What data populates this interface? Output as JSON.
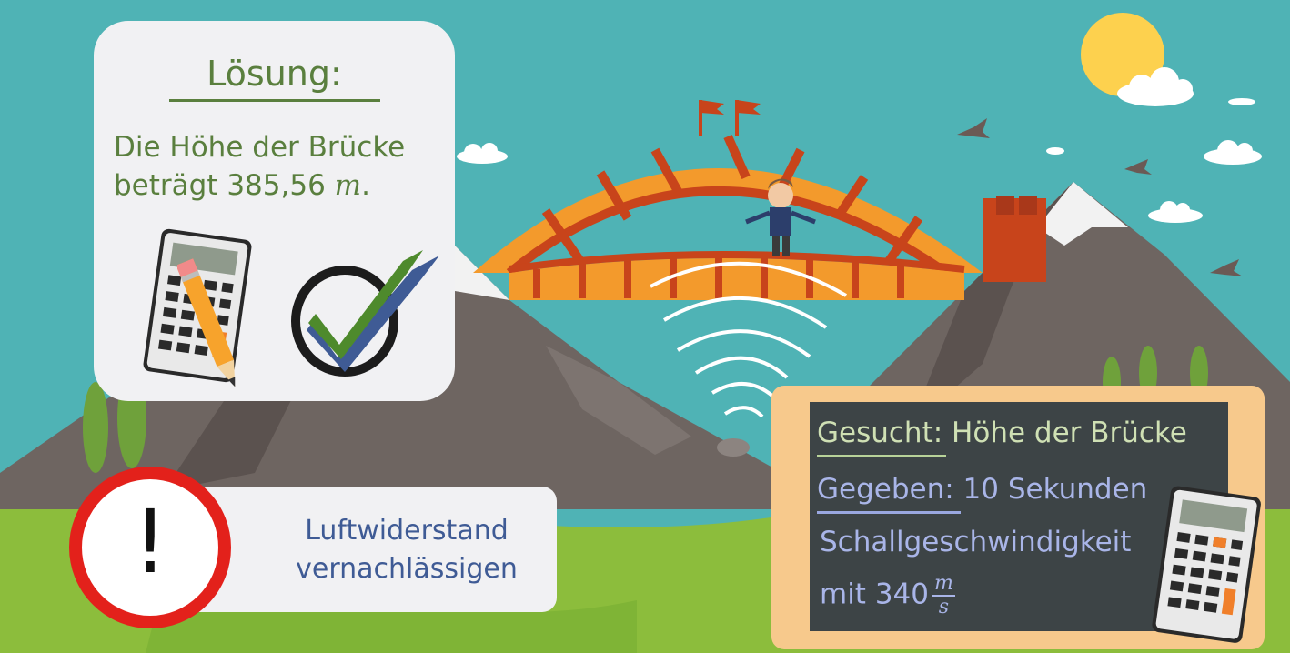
{
  "solution": {
    "title": "Lösung:",
    "line1": "Die Höhe der Brücke",
    "line2_prefix": "beträgt 385,56 ",
    "line2_unit": "m",
    "line2_suffix": "."
  },
  "warning": {
    "symbol": "!",
    "line1": "Luftwiderstand",
    "line2": "vernachlässigen"
  },
  "board": {
    "sought_label": "Gesucht:",
    "sought_value": " Höhe der Brücke",
    "given_label": "Gegeben:",
    "given_value": " 10 Sekunden",
    "speed_label": "Schallgeschwindigkeit",
    "speed_prefix": "mit 340",
    "unit_numerator": "m",
    "unit_denominator": "s"
  },
  "colors": {
    "sky": "#4fb3b5",
    "card": "#f1f1f3",
    "green_text": "#5a7f3e",
    "warning_red": "#e3211b",
    "blue_text": "#3f5b95",
    "board": "#3d4446",
    "frame": "#f7c98c",
    "bridge_orange": "#f39a2c",
    "bridge_red": "#c8441b"
  },
  "icons": [
    "sun-icon",
    "cloud-icon",
    "bird-icon",
    "flag-icon",
    "person-icon",
    "sound-wave-icon",
    "calculator-icon",
    "pencil-icon",
    "checkmark-icon",
    "exclamation-icon"
  ]
}
